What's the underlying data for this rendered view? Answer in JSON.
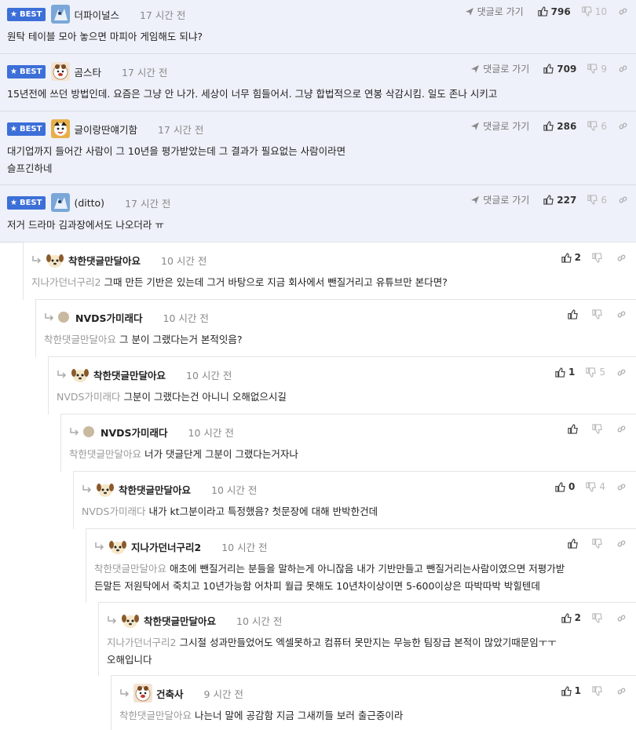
{
  "labels": {
    "best": "BEST",
    "reply_to": "댓글로 가기"
  },
  "colors": {
    "best_bg": "#eef1f9",
    "badge": "#3c6fd8",
    "mention": "#9a9a9a"
  },
  "best_comments": [
    {
      "nick": "더파이널스",
      "time": "17 시간 전",
      "up": "796",
      "down": "10",
      "lines": [
        "원탁 테이블 모아 놓으면 마피아 게임해도 되냐?"
      ]
    },
    {
      "nick": "곰스타",
      "time": "17 시간 전",
      "up": "709",
      "down": "9",
      "lines": [
        "15년전에 쓰던 방법인데. 요즘은 그냥 안 나가. 세상이 너무 힘들어서. 그냥 합법적으로 연봉 삭감시킴. 일도 존나 시키고"
      ]
    },
    {
      "nick": "글이랑딴얘기함",
      "time": "17 시간 전",
      "up": "286",
      "down": "6",
      "lines": [
        "대기업까지 들어간 사람이 그 10년을 평가받았는데 그 결과가 필요없는 사람이라면",
        "슬프긴하네"
      ]
    },
    {
      "nick": "(ditto)",
      "time": "17 시간 전",
      "up": "227",
      "down": "6",
      "lines": [
        "저거 드라마 김과장에서도 나오더라 ㅠ"
      ]
    }
  ],
  "thread": [
    {
      "nick": "착한댓글만달아요",
      "time": "10 시간 전",
      "up": "2",
      "down": "",
      "mention": "지나가던너구리2",
      "lines": [
        "그때 만든 기반은 있는데 그거 바탕으로 지금 회사에서 뺀질거리고 유튜브만 본다면?"
      ]
    },
    {
      "nick": "NVDS가미래다",
      "time": "10 시간 전",
      "up": "",
      "down": "",
      "mention": "착한댓글만달아요",
      "lines": [
        "그 분이 그랬다는거 본적잇음?"
      ]
    },
    {
      "nick": "착한댓글만달아요",
      "time": "10 시간 전",
      "up": "1",
      "down": "5",
      "mention": "NVDS가미래다",
      "lines": [
        "그분이 그랬다는건 아니니 오해없으시길"
      ]
    },
    {
      "nick": "NVDS가미래다",
      "time": "10 시간 전",
      "up": "",
      "down": "",
      "mention": "착한댓글만달아요",
      "lines": [
        "너가 댓글단게 그분이 그랬다는거자나"
      ]
    },
    {
      "nick": "착한댓글만달아요",
      "time": "10 시간 전",
      "up": "0",
      "down": "4",
      "mention": "NVDS가미래다",
      "lines": [
        "내가 kt그분이라고 특정했음? 첫문장에 대해 반박한건데"
      ]
    },
    {
      "nick": "지나가던너구리2",
      "time": "10 시간 전",
      "up": "",
      "down": "",
      "mention": "착한댓글만달아요",
      "lines": [
        "애초에 뺀질거리는 분들을 말하는게 아니잖음 내가 기반만들고 뺀질거리는사람이였으면 저평가받",
        "든말든 저원탁에서 죽치고 10년가능함 어차피 월급 못해도 10년차이상이면 5-600이상은 따박따박 박힐텐데"
      ]
    },
    {
      "nick": "착한댓글만달아요",
      "time": "10 시간 전",
      "up": "2",
      "down": "",
      "mention": "지나가던너구리2",
      "lines": [
        "그시절 성과만들었어도 엑셀못하고 컴퓨터 못만지는 무능한 팀장급 본적이 많았기때문임ㅜㅜ",
        "오해입니다"
      ]
    },
    {
      "nick": "건축사",
      "time": "9 시간 전",
      "up": "1",
      "down": "",
      "mention": "착한댓글만달아요",
      "lines": [
        "나는너 말에 공감함 지금 그새끼들 보러 출근중이라"
      ]
    }
  ]
}
